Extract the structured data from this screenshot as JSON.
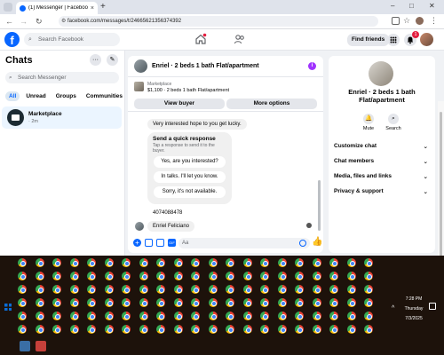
{
  "browser": {
    "tab_title": "(1) Messenger | Facebook",
    "tab_close": "×",
    "new_tab": "+",
    "url": "facebook.com/messages/t/24665621356374392",
    "window_controls": [
      "–",
      "□",
      "✕"
    ]
  },
  "fb": {
    "search_placeholder": "Search Facebook",
    "find_friends": "Find friends",
    "notification_count": "1",
    "logo_letter": "f"
  },
  "sidebar": {
    "title": "Chats",
    "more": "···",
    "search_placeholder": "Search Messenger",
    "filters": [
      "All",
      "Unread",
      "Groups",
      "Communities"
    ],
    "chat": {
      "name": "Marketplace",
      "time": "· 2m"
    }
  },
  "conversation": {
    "title": "Enriel · 2 beds 1 bath Flat/apartment",
    "info": "i",
    "listing_tag": "Marketplace",
    "listing_price": "$1,100 · 2 beds 1 bath Flat/apartment",
    "view_buyer": "View buyer",
    "more_options": "More options",
    "messages": {
      "m1": "Very interested hope to you get lucky.",
      "quick_title": "Send a quick response",
      "quick_sub": "Tap a response to send it to the buyer.",
      "quick_replies": [
        "Yes, are you interested?",
        "In talks. I'll let you know.",
        "Sorry, it's not available."
      ],
      "m2": "4074088478",
      "m3": "Enriel Feliciano"
    },
    "composer_placeholder": "Aa"
  },
  "details": {
    "name": "Enriel · 2 beds 1 bath Flat/apartment",
    "actions": [
      {
        "label": "Mute",
        "icon": "bell-icon"
      },
      {
        "label": "Search",
        "icon": "search-icon"
      }
    ],
    "rows": [
      "Customize chat",
      "Chat members",
      "Media, files and links",
      "Privacy & support"
    ]
  },
  "taskbar": {
    "time": "7:28 PM",
    "day": "Thursday",
    "date": "7/3/2025"
  },
  "colors": {
    "accent": "#0866ff",
    "badge": "#e41e3f",
    "info": "#a033ff"
  }
}
